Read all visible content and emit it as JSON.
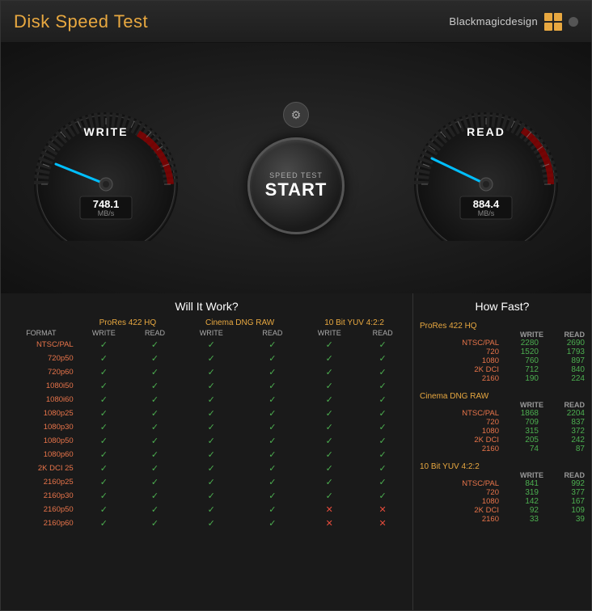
{
  "window": {
    "title": "Disk Speed Test",
    "brand": "Blackmagicdesign"
  },
  "gauges": {
    "write": {
      "label": "WRITE",
      "value": "748.1",
      "unit": "MB/s",
      "needle_angle": 195
    },
    "read": {
      "label": "READ",
      "value": "884.4",
      "unit": "MB/s",
      "needle_angle": 210
    }
  },
  "start_button": {
    "speed_test_label": "SPEED TEST",
    "start_label": "START"
  },
  "gear_icon": "⚙",
  "will_it_work": {
    "title": "Will It Work?",
    "group_headers": [
      "ProRes 422 HQ",
      "Cinema DNG RAW",
      "10 Bit YUV 4:2:2"
    ],
    "sub_headers": [
      "WRITE",
      "READ",
      "WRITE",
      "READ",
      "WRITE",
      "READ"
    ],
    "format_col_header": "FORMAT",
    "rows": [
      {
        "format": "NTSC/PAL",
        "checks": [
          true,
          true,
          true,
          true,
          true,
          true
        ]
      },
      {
        "format": "720p50",
        "checks": [
          true,
          true,
          true,
          true,
          true,
          true
        ]
      },
      {
        "format": "720p60",
        "checks": [
          true,
          true,
          true,
          true,
          true,
          true
        ]
      },
      {
        "format": "1080i50",
        "checks": [
          true,
          true,
          true,
          true,
          true,
          true
        ]
      },
      {
        "format": "1080i60",
        "checks": [
          true,
          true,
          true,
          true,
          true,
          true
        ]
      },
      {
        "format": "1080p25",
        "checks": [
          true,
          true,
          true,
          true,
          true,
          true
        ]
      },
      {
        "format": "1080p30",
        "checks": [
          true,
          true,
          true,
          true,
          true,
          true
        ]
      },
      {
        "format": "1080p50",
        "checks": [
          true,
          true,
          true,
          true,
          true,
          true
        ]
      },
      {
        "format": "1080p60",
        "checks": [
          true,
          true,
          true,
          true,
          true,
          true
        ]
      },
      {
        "format": "2K DCI 25",
        "checks": [
          true,
          true,
          true,
          true,
          true,
          true
        ]
      },
      {
        "format": "2160p25",
        "checks": [
          true,
          true,
          true,
          true,
          true,
          true
        ]
      },
      {
        "format": "2160p30",
        "checks": [
          true,
          true,
          true,
          true,
          true,
          true
        ]
      },
      {
        "format": "2160p50",
        "checks": [
          true,
          true,
          true,
          true,
          false,
          false
        ]
      },
      {
        "format": "2160p60",
        "checks": [
          true,
          true,
          true,
          true,
          false,
          false
        ]
      }
    ]
  },
  "how_fast": {
    "title": "How Fast?",
    "groups": [
      {
        "name": "ProRes 422 HQ",
        "col_write": "WRITE",
        "col_read": "READ",
        "rows": [
          {
            "label": "NTSC/PAL",
            "write": "2280",
            "read": "2690"
          },
          {
            "label": "720",
            "write": "1520",
            "read": "1793"
          },
          {
            "label": "1080",
            "write": "760",
            "read": "897"
          },
          {
            "label": "2K DCI",
            "write": "712",
            "read": "840"
          },
          {
            "label": "2160",
            "write": "190",
            "read": "224"
          }
        ]
      },
      {
        "name": "Cinema DNG RAW",
        "col_write": "WRITE",
        "col_read": "READ",
        "rows": [
          {
            "label": "NTSC/PAL",
            "write": "1868",
            "read": "2204"
          },
          {
            "label": "720",
            "write": "709",
            "read": "837"
          },
          {
            "label": "1080",
            "write": "315",
            "read": "372"
          },
          {
            "label": "2K DCI",
            "write": "205",
            "read": "242"
          },
          {
            "label": "2160",
            "write": "74",
            "read": "87"
          }
        ]
      },
      {
        "name": "10 Bit YUV 4:2:2",
        "col_write": "WRITE",
        "col_read": "READ",
        "rows": [
          {
            "label": "NTSC/PAL",
            "write": "841",
            "read": "992"
          },
          {
            "label": "720",
            "write": "319",
            "read": "377"
          },
          {
            "label": "1080",
            "write": "142",
            "read": "167"
          },
          {
            "label": "2K DCI",
            "write": "92",
            "read": "109"
          },
          {
            "label": "2160",
            "write": "33",
            "read": "39"
          }
        ]
      }
    ]
  }
}
